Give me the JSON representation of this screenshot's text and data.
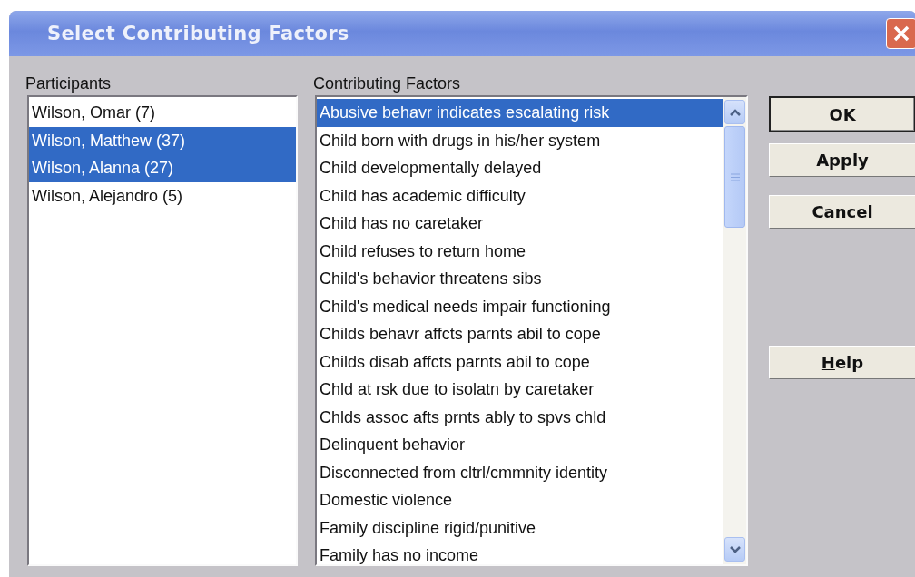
{
  "window": {
    "title": "Select Contributing Factors"
  },
  "participants": {
    "label": "Participants",
    "items": [
      {
        "text": "Wilson, Omar  (7)",
        "selected": false
      },
      {
        "text": "Wilson, Matthew  (37)",
        "selected": true
      },
      {
        "text": "Wilson, Alanna  (27)",
        "selected": true
      },
      {
        "text": "Wilson, Alejandro  (5)",
        "selected": false
      }
    ]
  },
  "factors": {
    "label": "Contributing Factors",
    "items": [
      {
        "text": "Abusive behavr indicates escalating risk",
        "selected": true
      },
      {
        "text": "Child born with drugs in his/her system",
        "selected": false
      },
      {
        "text": "Child developmentally delayed",
        "selected": false
      },
      {
        "text": "Child has academic difficulty",
        "selected": false
      },
      {
        "text": "Child has no caretaker",
        "selected": false
      },
      {
        "text": "Child refuses to return home",
        "selected": false
      },
      {
        "text": "Child's behavior threatens sibs",
        "selected": false
      },
      {
        "text": "Child's medical needs impair functioning",
        "selected": false
      },
      {
        "text": "Childs behavr affcts parnts abil to cope",
        "selected": false
      },
      {
        "text": "Childs disab affcts parnts abil to cope",
        "selected": false
      },
      {
        "text": "Chld at rsk due to isolatn by caretaker",
        "selected": false
      },
      {
        "text": "Chlds assoc afts prnts ably to spvs chld",
        "selected": false
      },
      {
        "text": "Delinquent behavior",
        "selected": false
      },
      {
        "text": "Disconnected from cltrl/cmmnity identity",
        "selected": false
      },
      {
        "text": "Domestic violence",
        "selected": false
      },
      {
        "text": "Family discipline rigid/punitive",
        "selected": false
      },
      {
        "text": "Family has no income",
        "selected": false
      }
    ]
  },
  "buttons": [
    {
      "label": "OK",
      "default": true,
      "mnemonic": false
    },
    {
      "label": "Apply",
      "default": false,
      "mnemonic": false
    },
    {
      "label": "Cancel",
      "default": false,
      "mnemonic": false
    },
    {
      "label": "Help",
      "default": false,
      "mnemonic": true
    }
  ]
}
